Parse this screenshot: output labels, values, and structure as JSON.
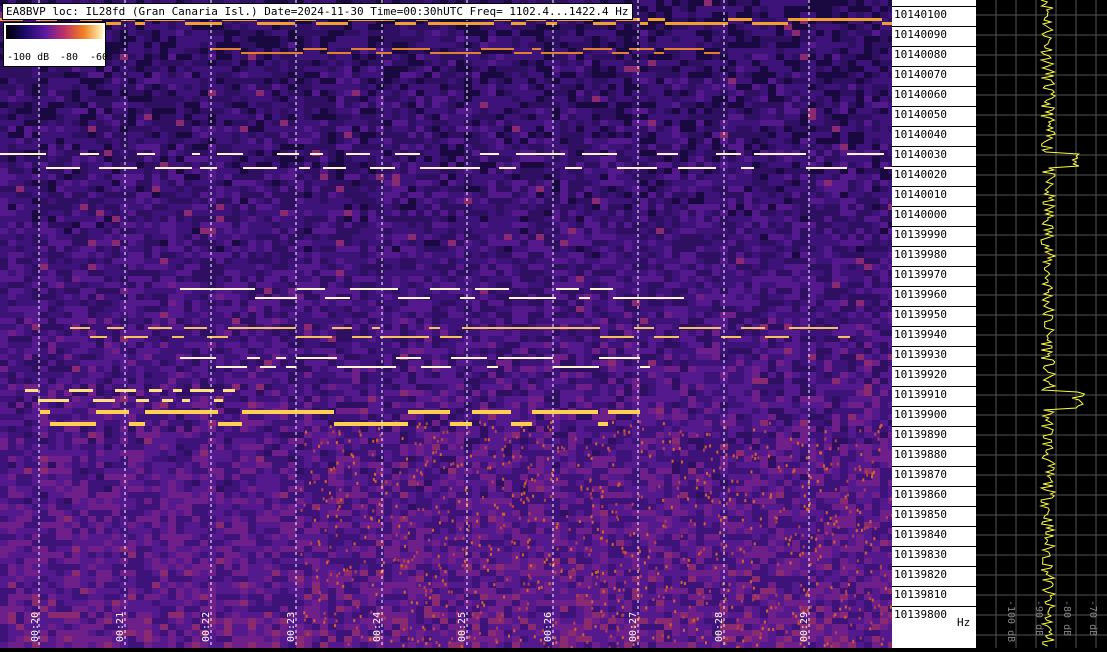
{
  "header": {
    "title": "EA8BVP loc: IL28fd (Gran Canaria Isl.) Date=2024-11-30 Time=00:30hUTC Freq= 1102.4...1422.4 Hz"
  },
  "legend": {
    "labels": [
      "-100 dB",
      "-80",
      "-60"
    ]
  },
  "freq_axis": {
    "labels": [
      "10140100",
      "10140090",
      "10140080",
      "10140070",
      "10140060",
      "10140050",
      "10140040",
      "10140030",
      "10140020",
      "10140010",
      "10140000",
      "10139990",
      "10139980",
      "10139970",
      "10139960",
      "10139950",
      "10139940",
      "10139930",
      "10139920",
      "10139910",
      "10139900",
      "10139890",
      "10139880",
      "10139870",
      "10139860",
      "10139850",
      "10139840",
      "10139830",
      "10139820",
      "10139810",
      "10139800"
    ],
    "unit": "Hz"
  },
  "time_axis": {
    "labels": [
      "00:20",
      "00:21",
      "00:22",
      "00:23",
      "00:24",
      "00:25",
      "00:26",
      "00:27",
      "00:28",
      "00:29"
    ]
  },
  "spectrum": {
    "db_labels": [
      "-100 dB",
      "-90 dB",
      "-80 dB",
      "-70 dB"
    ]
  }
}
